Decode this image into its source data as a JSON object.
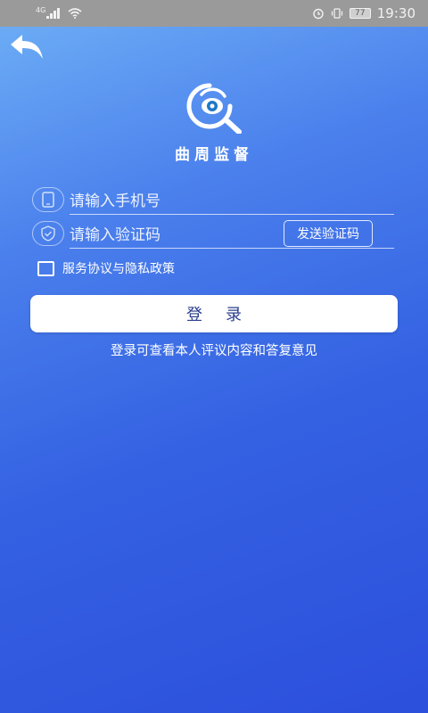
{
  "status_bar": {
    "network_label": "4G",
    "battery_level": "77",
    "time": "19:30"
  },
  "header": {
    "app_title": "曲周监督"
  },
  "form": {
    "phone_placeholder": "请输入手机号",
    "code_placeholder": "请输入验证码",
    "send_code_label": "发送验证码",
    "agreement_label": "服务协议与隐私政策",
    "agreement_checked": false,
    "login_label": "登录"
  },
  "footer": {
    "hint": "登录可查看本人评议内容和答复意见"
  },
  "icons": {
    "back": "back-arrow-icon",
    "logo": "eye-magnifier-icon",
    "phone": "phone-icon",
    "code": "shield-check-icon"
  },
  "colors": {
    "background_top": "#6fb0f6",
    "background_bottom": "#2c4fdc",
    "status_bar": "#9a9a9a",
    "button_bg": "#ffffff",
    "button_text": "#2a3d8c"
  }
}
